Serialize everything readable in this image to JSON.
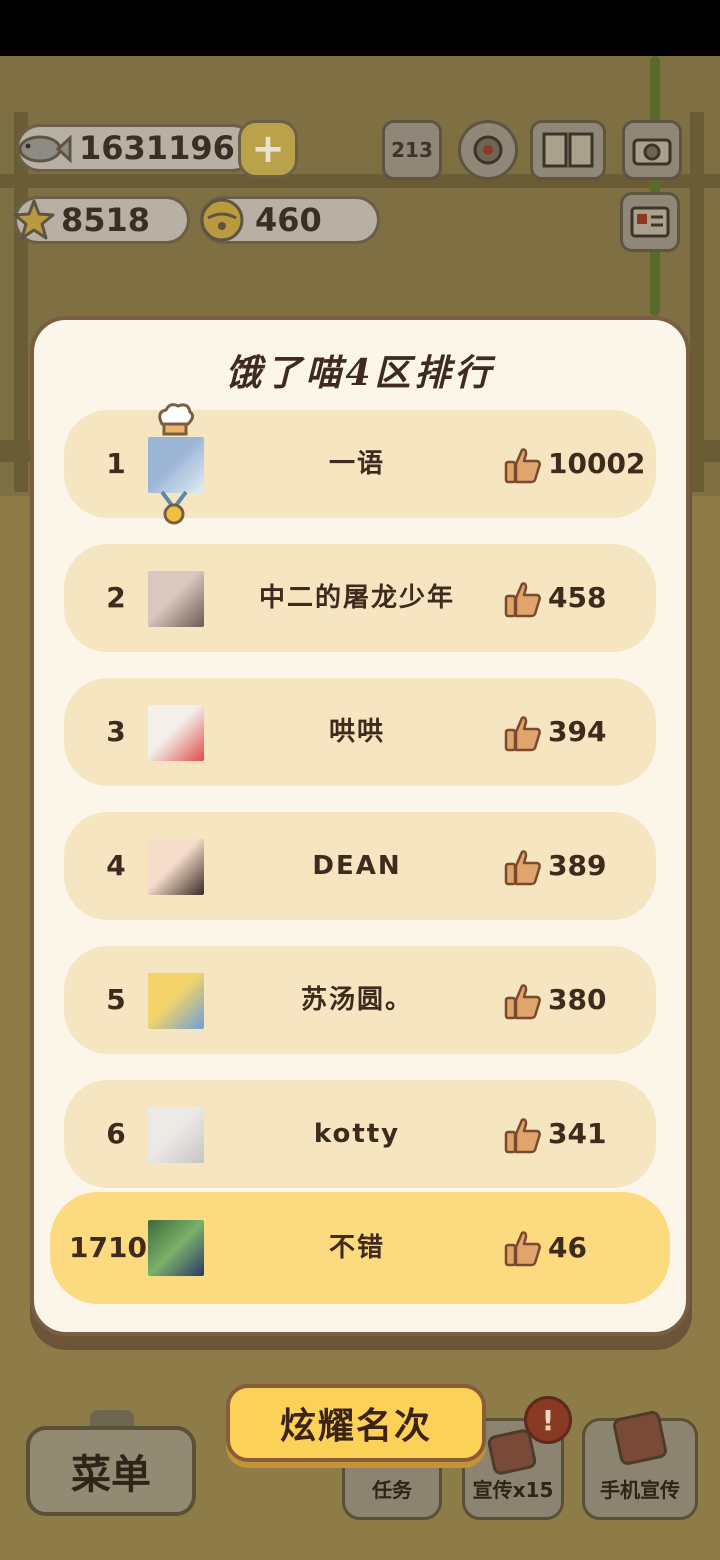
{
  "hud": {
    "fish_count": "1631196",
    "star_count": "8518",
    "bell_count": "460",
    "plus_label": "+",
    "rank_icon_label": "213"
  },
  "modal": {
    "title": "饿了喵4区排行",
    "rows": [
      {
        "rank": "1",
        "name": "一语",
        "likes": "10002"
      },
      {
        "rank": "2",
        "name": "中二的屠龙少年",
        "likes": "458"
      },
      {
        "rank": "3",
        "name": "哄哄",
        "likes": "394"
      },
      {
        "rank": "4",
        "name": "DEAN",
        "likes": "389"
      },
      {
        "rank": "5",
        "name": "苏汤圆。",
        "likes": "380"
      },
      {
        "rank": "6",
        "name": "kotty",
        "likes": "341"
      }
    ],
    "me": {
      "rank": "1710",
      "name": "不错",
      "likes": "46"
    }
  },
  "bottom": {
    "menu_label": "菜单",
    "task_label": "任务",
    "promo_label": "宣传x15",
    "phone_promo_label": "手机宣传",
    "brag_label": "炫耀名次",
    "alert_label": "!"
  },
  "icons": {
    "like": "thumbs-up-icon",
    "fish": "fish-icon",
    "star": "star-icon",
    "bell": "bell-icon"
  },
  "colors": {
    "row_bg": "#f5e5c1",
    "me_row_bg": "#fcda80",
    "modal_bg": "#fbf5ea",
    "brag_button": "#fbd257",
    "thumb": "#e0a56c"
  }
}
